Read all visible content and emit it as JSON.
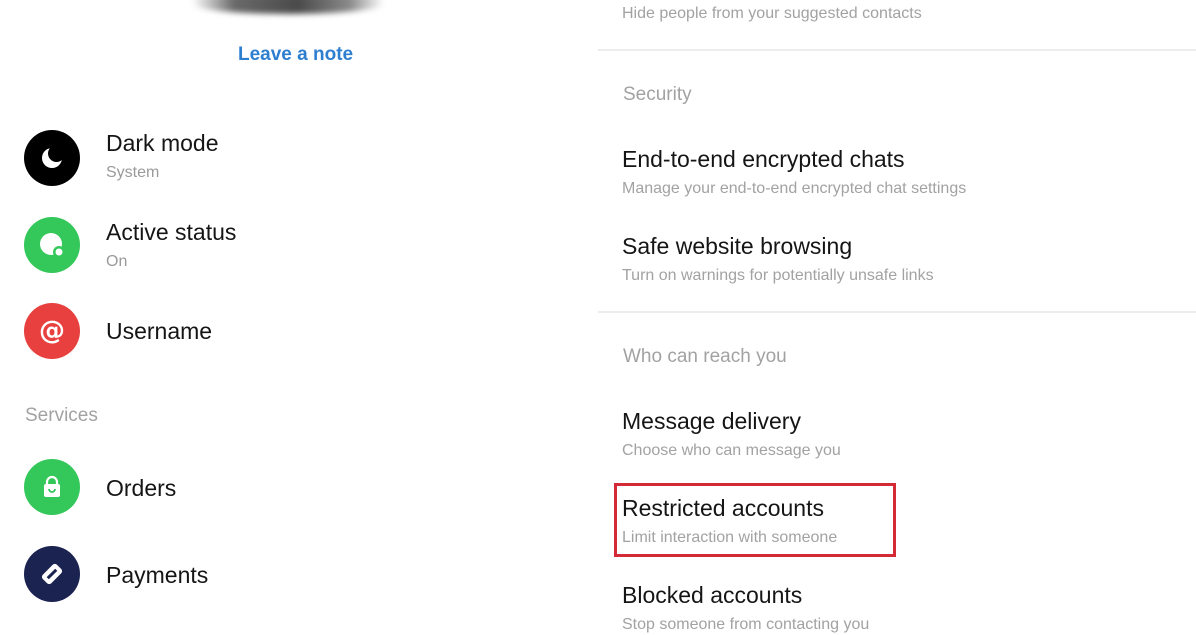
{
  "left": {
    "leave_note": "Leave a note",
    "rows": [
      {
        "title": "Dark mode",
        "sub": "System",
        "icon": "moon-icon",
        "color": "#000000"
      },
      {
        "title": "Active status",
        "sub": "On",
        "icon": "active-status-icon",
        "color": "#34c85a"
      },
      {
        "title": "Username",
        "icon": "at-sign-icon",
        "color": "#e8403f"
      }
    ],
    "services_label": "Services",
    "services": [
      {
        "title": "Orders",
        "icon": "shopping-bag-icon",
        "color": "#34c85a"
      },
      {
        "title": "Payments",
        "icon": "payment-card-icon",
        "color": "#1b2350"
      }
    ]
  },
  "right": {
    "top_sub": "Hide people from your suggested contacts",
    "security_label": "Security",
    "security_items": [
      {
        "title": "End-to-end encrypted chats",
        "sub": "Manage your end-to-end encrypted chat settings"
      },
      {
        "title": "Safe website browsing",
        "sub": "Turn on warnings for potentially unsafe links"
      }
    ],
    "reach_label": "Who can reach you",
    "reach_items": [
      {
        "title": "Message delivery",
        "sub": "Choose who can message you"
      },
      {
        "title": "Restricted accounts",
        "sub": "Limit interaction with someone"
      },
      {
        "title": "Blocked accounts",
        "sub": "Stop someone from contacting you"
      }
    ]
  },
  "colors": {
    "link": "#2f7fd1",
    "highlight": "#d42a35"
  }
}
